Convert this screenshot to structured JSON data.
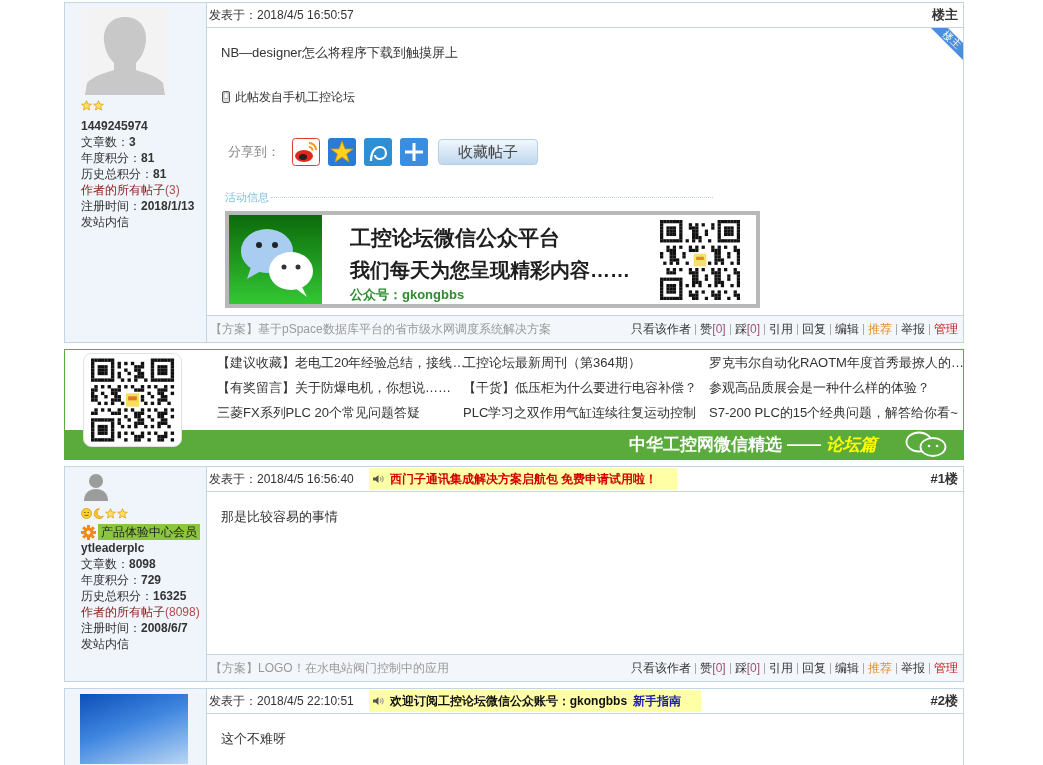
{
  "thread": [
    {
      "kind": "post",
      "author": {
        "avatar": {
          "kind": "default"
        },
        "rank_icons": [
          {
            "kind": "star"
          },
          {
            "kind": "star"
          }
        ],
        "name": "1449245974",
        "stats": [
          {
            "label": "文章数：",
            "value": "3"
          },
          {
            "label": "年度积分：",
            "value": "81"
          },
          {
            "label": "历史总积分：",
            "value": "81"
          }
        ],
        "all_posts": {
          "label": "作者的所有帖子",
          "count": "(3)"
        },
        "registered": {
          "label": "注册时间：",
          "value": "2018/1/13"
        },
        "message_link": "发站内信"
      },
      "posted": "发表于：2018/4/5 16:50:57",
      "floor": "楼主",
      "ribbon": "楼主",
      "body": "NB—designer怎么将程序下载到触摸屏上",
      "mobile_note": "此帖发自手机工控论坛",
      "share": {
        "label": "分享到：",
        "favorite_button": "收藏帖子"
      },
      "activity": {
        "label": "活动信息",
        "banner": {
          "title": "工控论坛微信公众平台",
          "subtitle": "我们每天为您呈现精彩内容……",
          "account": "公众号：gkongbbs"
        }
      },
      "related": "【方案】基于pSpace数据库平台的省市级水网调度系统解决方案",
      "actions": [
        {
          "kind": "link",
          "label": "只看该作者"
        },
        {
          "kind": "vote",
          "label": "赞",
          "count": "[0]"
        },
        {
          "kind": "vote",
          "label": "踩",
          "count": "[0]"
        },
        {
          "kind": "link",
          "label": "引用"
        },
        {
          "kind": "link",
          "label": "回复"
        },
        {
          "kind": "link",
          "label": "编辑"
        },
        {
          "kind": "recommend",
          "label": "推荐"
        },
        {
          "kind": "link",
          "label": "举报"
        },
        {
          "kind": "manage",
          "label": "管理"
        }
      ]
    },
    {
      "kind": "wechat_picks",
      "links": [
        "【建议收藏】老电工20年经验总结，接线…",
        "工控论坛最新周刊（第364期）",
        "罗克韦尔自动化RAOTM年度首秀最撩人的…",
        "【有奖留言】关于防爆电机，你想说……",
        "【干货】低压柜为什么要进行电容补偿？",
        "参观高品质展会是一种什么样的体验？",
        "三菱FX系列PLC 20个常见问题答疑",
        "PLC学习之双作用气缸连续往复运动控制",
        "S7-200 PLC的15个经典问题，解答给你看~"
      ],
      "title": "中华工控网微信精选 ——",
      "tag": "论坛篇"
    },
    {
      "kind": "post",
      "author": {
        "avatar": {
          "kind": "icon"
        },
        "rank_icons": [
          {
            "kind": "smiley"
          },
          {
            "kind": "moon"
          },
          {
            "kind": "star"
          },
          {
            "kind": "star"
          }
        ],
        "badge": "产品体验中心会员",
        "name": "ytleaderplc",
        "stats": [
          {
            "label": "文章数：",
            "value": "8098"
          },
          {
            "label": "年度积分：",
            "value": "729"
          },
          {
            "label": "历史总积分：",
            "value": "16325"
          }
        ],
        "all_posts": {
          "label": "作者的所有帖子",
          "count": "(8098)"
        },
        "registered": {
          "label": "注册时间：",
          "value": "2008/6/7"
        },
        "message_link": "发站内信"
      },
      "posted": "发表于：2018/4/5 16:56:40",
      "ad": {
        "kind": "promo",
        "text": "西门子通讯集成解决方案启航包 免费申请试用啦！"
      },
      "floor": "#1楼",
      "body": "那是比较容易的事情",
      "related": "【方案】LOGO！在水电站阀门控制中的应用",
      "actions": [
        {
          "kind": "link",
          "label": "只看该作者"
        },
        {
          "kind": "vote",
          "label": "赞",
          "count": "[0]"
        },
        {
          "kind": "vote",
          "label": "踩",
          "count": "[0]"
        },
        {
          "kind": "link",
          "label": "引用"
        },
        {
          "kind": "link",
          "label": "回复"
        },
        {
          "kind": "link",
          "label": "编辑"
        },
        {
          "kind": "recommend",
          "label": "推荐"
        },
        {
          "kind": "link",
          "label": "举报"
        },
        {
          "kind": "manage",
          "label": "管理"
        }
      ]
    },
    {
      "kind": "post",
      "author": {
        "avatar": {
          "kind": "photo"
        }
      },
      "posted": "发表于：2018/4/5 22:10:51",
      "ad": {
        "kind": "notice",
        "text": "欢迎订阅工控论坛微信公众账号：gkongbbs",
        "link": "新手指南"
      },
      "floor": "#2楼",
      "body": "这个不难呀"
    }
  ]
}
